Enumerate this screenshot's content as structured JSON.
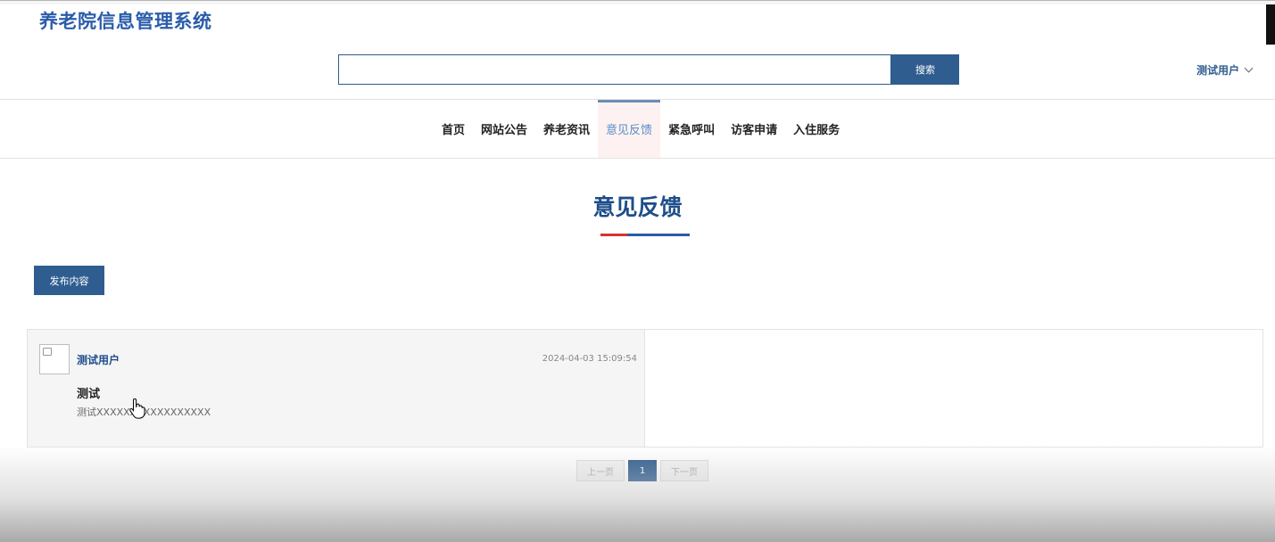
{
  "header": {
    "site_title": "养老院信息管理系统",
    "search": {
      "value": "",
      "placeholder": "",
      "button_label": "搜索"
    },
    "user": {
      "name": "测试用户"
    }
  },
  "nav": {
    "items": [
      {
        "label": "首页",
        "active": false
      },
      {
        "label": "网站公告",
        "active": false
      },
      {
        "label": "养老资讯",
        "active": false
      },
      {
        "label": "意见反馈",
        "active": true
      },
      {
        "label": "紧急呼叫",
        "active": false
      },
      {
        "label": "访客申请",
        "active": false
      },
      {
        "label": "入住服务",
        "active": false
      }
    ]
  },
  "main": {
    "title": "意见反馈",
    "publish_label": "发布内容",
    "feedback": [
      {
        "user": "测试用户",
        "time": "2024-04-03 15:09:54",
        "title": "测试",
        "content": "测试XXXXXXXXXXXXXXXXX"
      }
    ]
  },
  "pagination": {
    "prev": "上一页",
    "current": "1",
    "next": "下一页"
  },
  "colors": {
    "primary": "#2f5d8f",
    "title": "#1e4d8a",
    "accent_red": "#d9332b"
  }
}
